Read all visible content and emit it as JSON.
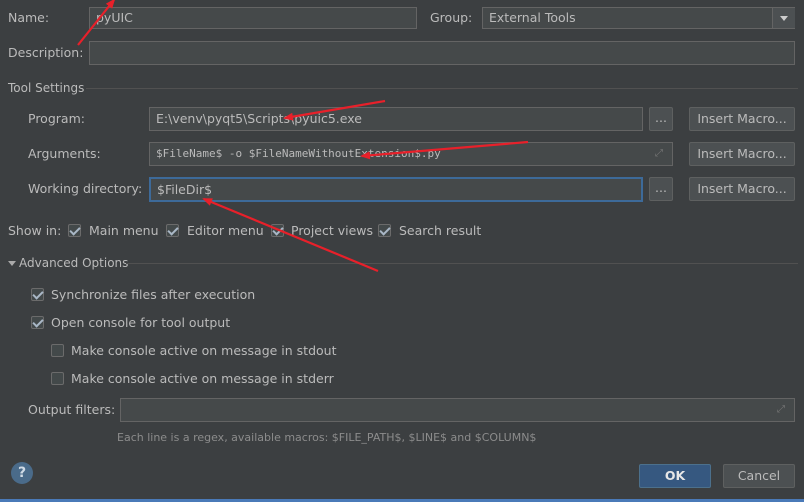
{
  "name": {
    "label": "Name:",
    "value": "pyUIC"
  },
  "group": {
    "label": "Group:",
    "value": "External Tools"
  },
  "description": {
    "label": "Description:",
    "value": ""
  },
  "tool_settings": {
    "title": "Tool Settings",
    "program": {
      "label": "Program:",
      "value": "E:\\venv\\pyqt5\\Scripts\\pyuic5.exe"
    },
    "arguments": {
      "label": "Arguments:",
      "value": "$FileName$ -o $FileNameWithoutExtension$.py"
    },
    "working_directory": {
      "label": "Working directory:",
      "value": "$FileDir$"
    },
    "browse_label": "...",
    "insert_macro_label": "Insert Macro..."
  },
  "show_in": {
    "label": "Show in:",
    "options": [
      {
        "label": "Main menu",
        "checked": true
      },
      {
        "label": "Editor menu",
        "checked": true
      },
      {
        "label": "Project views",
        "checked": true
      },
      {
        "label": "Search result",
        "checked": true
      }
    ]
  },
  "advanced": {
    "title": "Advanced Options",
    "options": [
      {
        "label": "Synchronize files after execution",
        "checked": true
      },
      {
        "label": "Open console for tool output",
        "checked": true
      },
      {
        "label": "Make console active on message in stdout",
        "checked": false
      },
      {
        "label": "Make console active on message in stderr",
        "checked": false
      }
    ],
    "output_filters": {
      "label": "Output filters:",
      "value": ""
    },
    "hint": "Each line is a regex, available macros: $FILE_PATH$, $LINE$ and $COLUMN$"
  },
  "footer": {
    "help_glyph": "?",
    "ok_label": "OK",
    "cancel_label": "Cancel"
  },
  "colors": {
    "background": "#3c3f41",
    "primary_button": "#365880",
    "annotation_arrow": "#e8202a"
  }
}
